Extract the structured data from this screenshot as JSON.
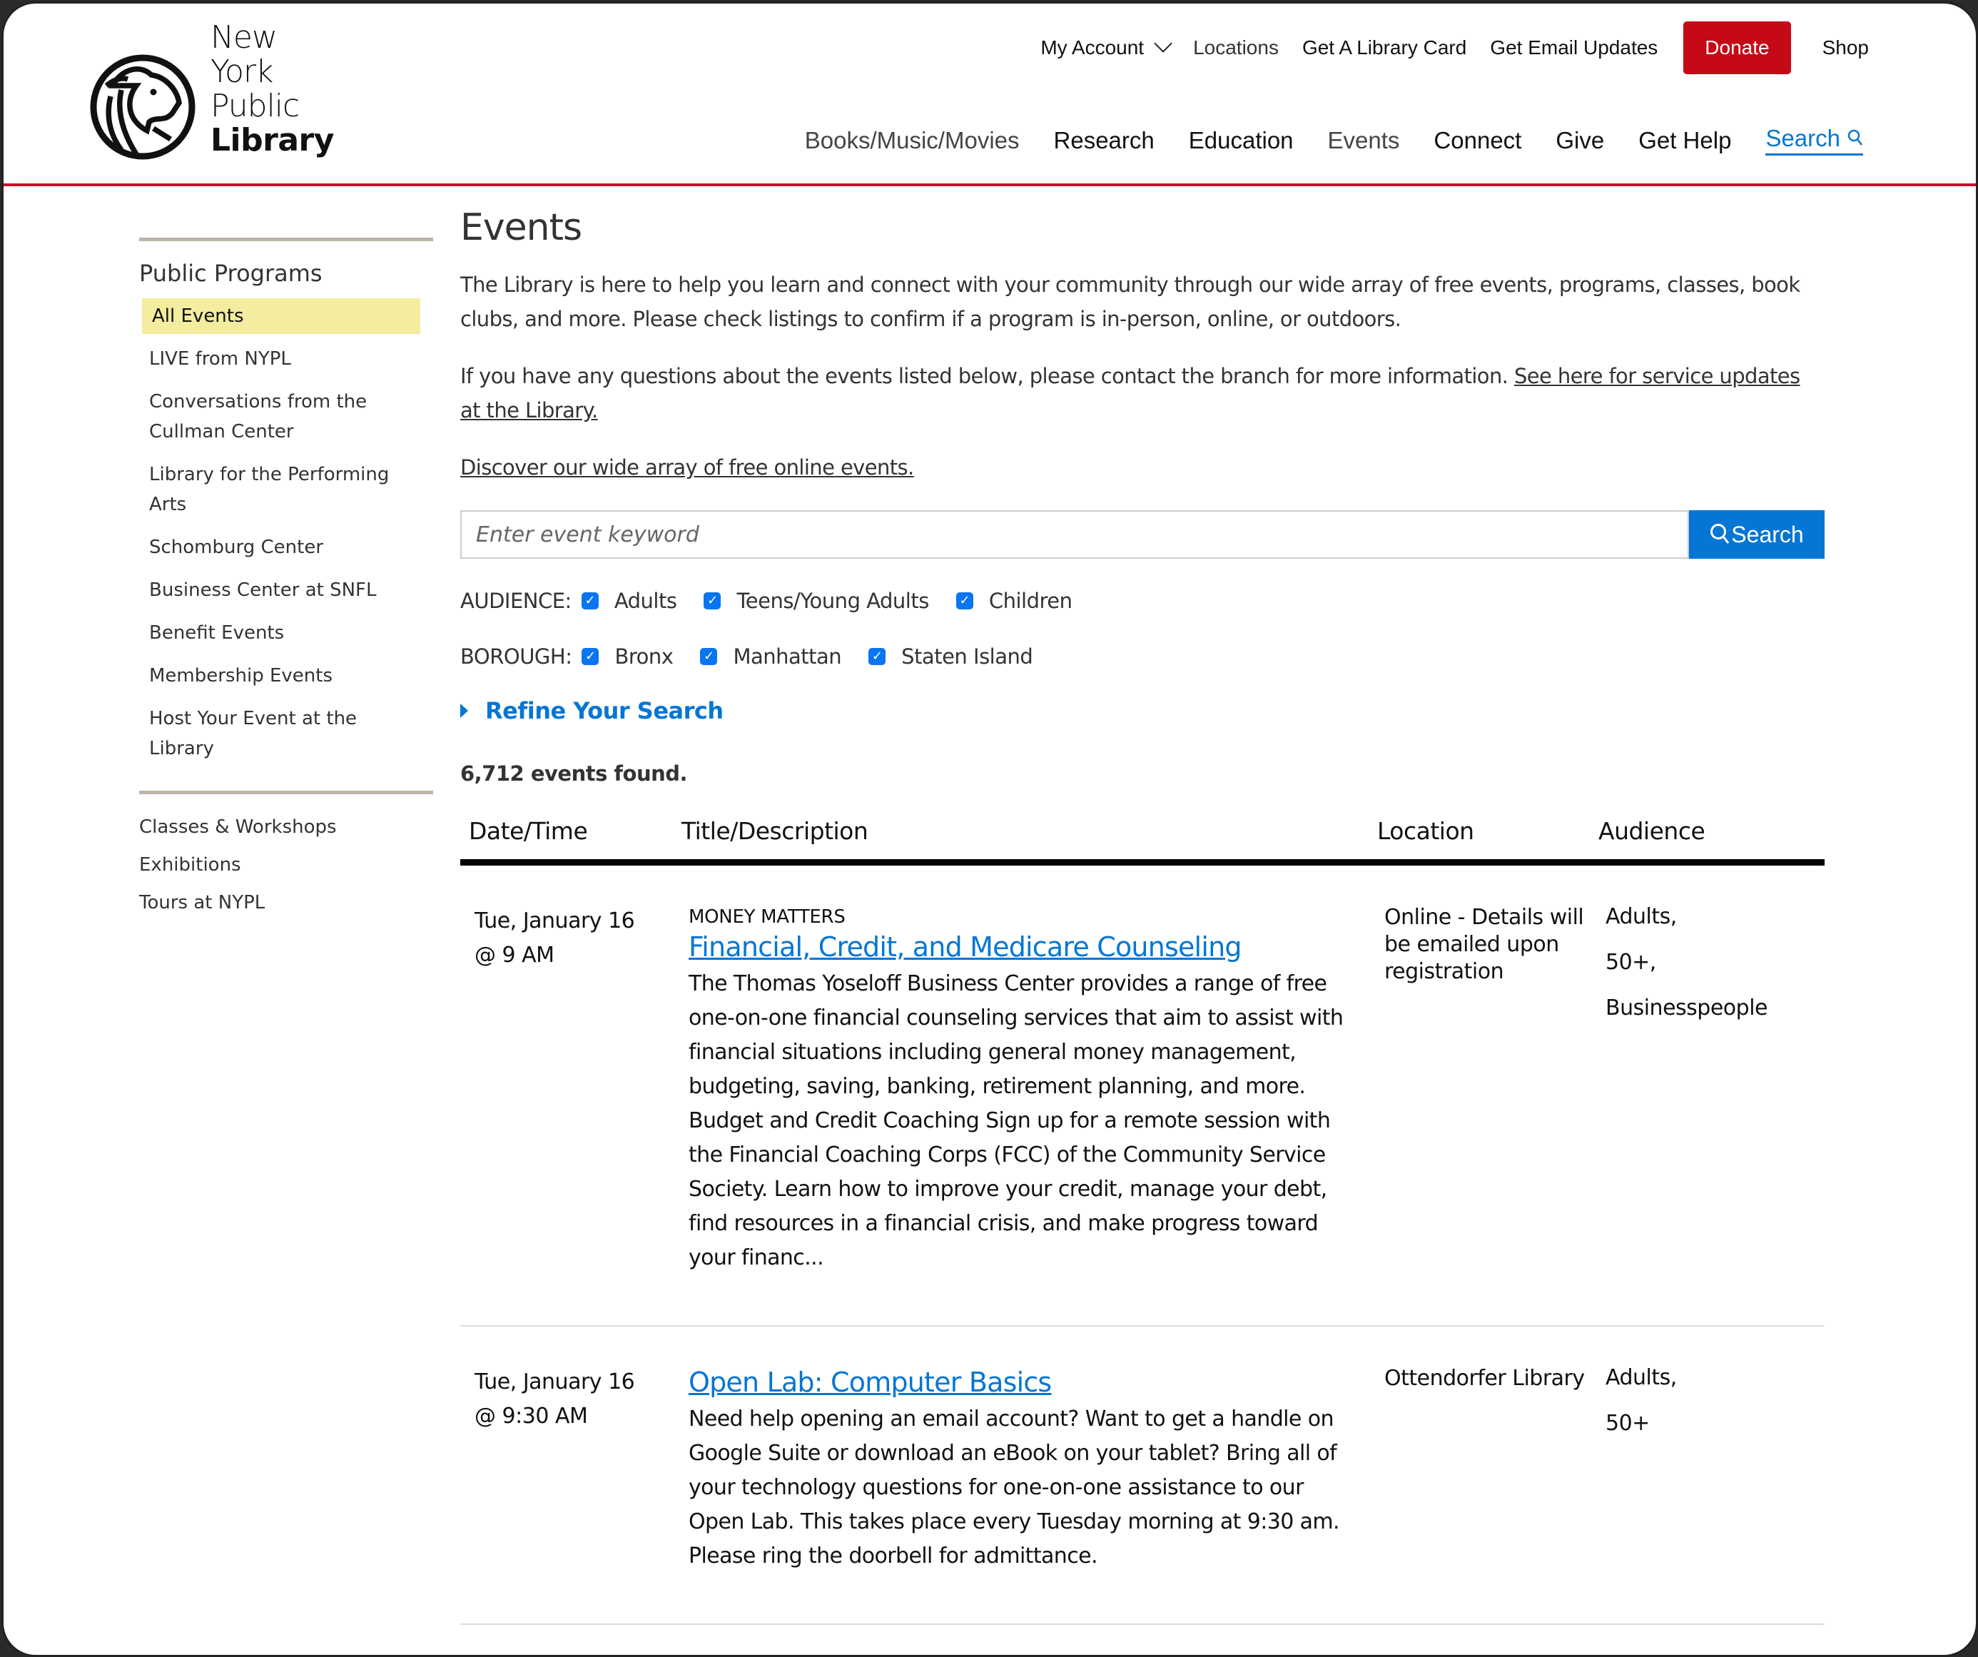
{
  "header": {
    "logo": {
      "line1": "New York",
      "line2": "Public",
      "line3": "Library"
    },
    "utility_nav": {
      "my_account": "My Account",
      "locations": "Locations",
      "library_card": "Get A Library Card",
      "email_updates": "Get Email Updates",
      "donate": "Donate",
      "shop": "Shop"
    },
    "main_nav": [
      {
        "label": "Books/Music/Movies"
      },
      {
        "label": "Research"
      },
      {
        "label": "Education"
      },
      {
        "label": "Events"
      },
      {
        "label": "Connect"
      },
      {
        "label": "Give"
      },
      {
        "label": "Get Help"
      },
      {
        "label": "Search"
      }
    ]
  },
  "sidebar": {
    "heading": "Public Programs",
    "items": [
      {
        "label": "All Events",
        "active": true
      },
      {
        "label": "LIVE from NYPL"
      },
      {
        "label": "Conversations from the Cullman Center"
      },
      {
        "label": "Library for the Performing Arts"
      },
      {
        "label": "Schomburg Center"
      },
      {
        "label": "Business Center at SNFL"
      },
      {
        "label": "Benefit Events"
      },
      {
        "label": "Membership Events"
      },
      {
        "label": "Host Your Event at the Library"
      }
    ],
    "secondary": [
      {
        "label": "Classes & Workshops"
      },
      {
        "label": "Exhibitions"
      },
      {
        "label": "Tours at NYPL"
      }
    ]
  },
  "main": {
    "title": "Events",
    "intro1": "The Library is here to help you learn and connect with your community through our wide array of free events, programs, classes, book clubs, and more. Please check listings to confirm if a program is in-person, online, or outdoors.",
    "intro2_text": "If you have any questions about the events listed below, please contact the branch for more information. ",
    "intro2_link": "See here for service updates at the Library.",
    "online_link": "Discover our wide array of free online events.",
    "search": {
      "placeholder": "Enter event keyword",
      "value": "",
      "button": "Search"
    },
    "audience": {
      "label": "AUDIENCE:",
      "options": [
        {
          "label": "Adults",
          "checked": true
        },
        {
          "label": "Teens/Young Adults",
          "checked": true
        },
        {
          "label": "Children",
          "checked": true
        }
      ]
    },
    "borough": {
      "label": "BOROUGH:",
      "options": [
        {
          "label": "Bronx",
          "checked": true
        },
        {
          "label": "Manhattan",
          "checked": true
        },
        {
          "label": "Staten Island",
          "checked": true
        }
      ]
    },
    "refine": "Refine Your Search",
    "count": "6,712 events found."
  },
  "table": {
    "headers": {
      "date": "Date/Time",
      "title": "Title/Description",
      "location": "Location",
      "audience": "Audience"
    },
    "rows": [
      {
        "date": "Tue, January 16",
        "time": "@ 9 AM",
        "category": "MONEY MATTERS",
        "title": "Financial, Credit, and Medicare Counseling",
        "description": "The Thomas Yoseloff Business Center provides a range of free one-on-one financial counseling services that aim to assist with financial situations including general money management, budgeting, saving, banking, retirement planning, and more. Budget and Credit Coaching Sign up for a remote session with the Financial Coaching Corps (FCC) of the Community Service Society. Learn how to improve your credit, manage your debt, find resources in a financial crisis, and make progress toward your financ...",
        "location": "Online - Details will be emailed upon registration",
        "audience": [
          "Adults,",
          "50+,",
          "Businesspeople"
        ]
      },
      {
        "date": "Tue, January 16",
        "time": "@ 9:30 AM",
        "category": "",
        "title": "Open Lab: Computer Basics",
        "description": "Need help opening an email account? Want to get a handle on Google Suite or download an eBook on your tablet? Bring all of your technology questions for one-on-one assistance to our Open Lab. This takes place every Tuesday morning at 9:30 am. Please ring the doorbell for admittance.",
        "location": "Ottendorfer Library",
        "audience": [
          "Adults,",
          "50+"
        ]
      }
    ]
  },
  "colors": {
    "brand_red": "#c8102e",
    "donate_red": "#c60917",
    "link_blue": "#0576d3",
    "active_highlight": "#f4ec9f",
    "sidebar_rule": "#bdb5a6"
  }
}
